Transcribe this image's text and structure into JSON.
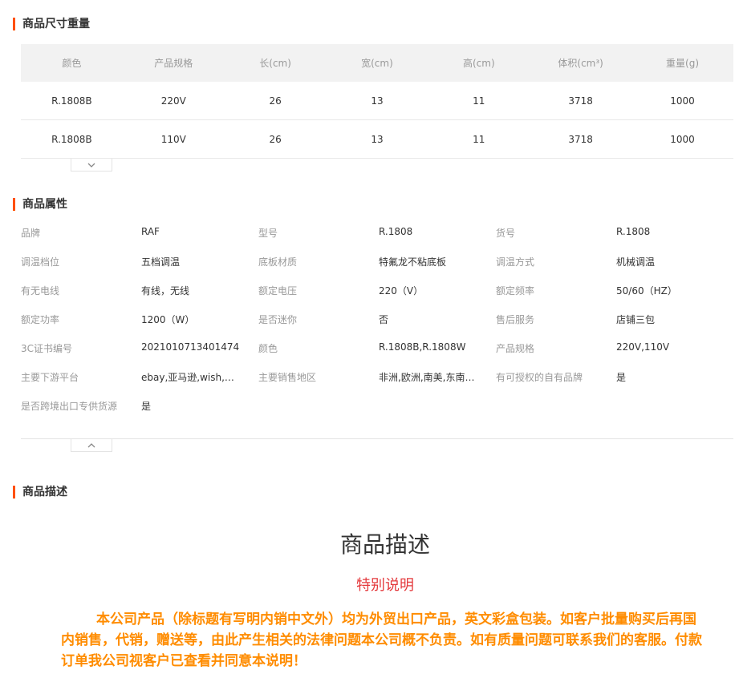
{
  "size_section": {
    "title": "商品尺寸重量",
    "columns": [
      "颜色",
      "产品规格",
      "长(cm)",
      "宽(cm)",
      "高(cm)",
      "体积(cm³)",
      "重量(g)"
    ],
    "rows": [
      [
        "R.1808B",
        "220V",
        "26",
        "13",
        "11",
        "3718",
        "1000"
      ],
      [
        "R.1808B",
        "110V",
        "26",
        "13",
        "11",
        "3718",
        "1000"
      ]
    ],
    "toggle_icon": "chevron-down-icon"
  },
  "attr_section": {
    "title": "商品属性",
    "rows": [
      [
        [
          "品牌",
          "RAF"
        ],
        [
          "型号",
          "R.1808"
        ],
        [
          "货号",
          "R.1808"
        ]
      ],
      [
        [
          "调温档位",
          "五档调温"
        ],
        [
          "底板材质",
          "特氟龙不粘底板"
        ],
        [
          "调温方式",
          "机械调温"
        ]
      ],
      [
        [
          "有无电线",
          "有线，无线"
        ],
        [
          "额定电压",
          "220（V）"
        ],
        [
          "额定频率",
          "50/60（HZ）"
        ]
      ],
      [
        [
          "额定功率",
          "1200（W）"
        ],
        [
          "是否迷你",
          "否"
        ],
        [
          "售后服务",
          "店铺三包"
        ]
      ],
      [
        [
          "3C证书编号",
          "2021010713401474"
        ],
        [
          "颜色",
          "R.1808B,R.1808W"
        ],
        [
          "产品规格",
          "220V,110V"
        ]
      ],
      [
        [
          "主要下游平台",
          "ebay,亚马逊,wish,速…"
        ],
        [
          "主要销售地区",
          "非洲,欧洲,南美,东南…"
        ],
        [
          "有可授权的自有品牌",
          "是"
        ]
      ],
      [
        [
          "是否跨境出口专供货源",
          "是"
        ]
      ]
    ],
    "toggle_icon": "chevron-up-icon"
  },
  "desc_section": {
    "title": "商品描述",
    "heading": "商品描述",
    "subheading": "特别说明",
    "body": "本公司产品（除标题有写明内销中文外）均为外贸出口产品，英文彩盒包装。如客户批量购买后再国内销售，代销，赠送等，由此产生相关的法律问题本公司概不负责。如有质量问题可联系我们的客服。付款订单我公司视客户已查看并同意本说明！",
    "colors": {
      "heading": "#333333",
      "subheading": "#e4393c",
      "body": "#ff8c00"
    }
  },
  "colors": {
    "accent": "#ff5000"
  }
}
